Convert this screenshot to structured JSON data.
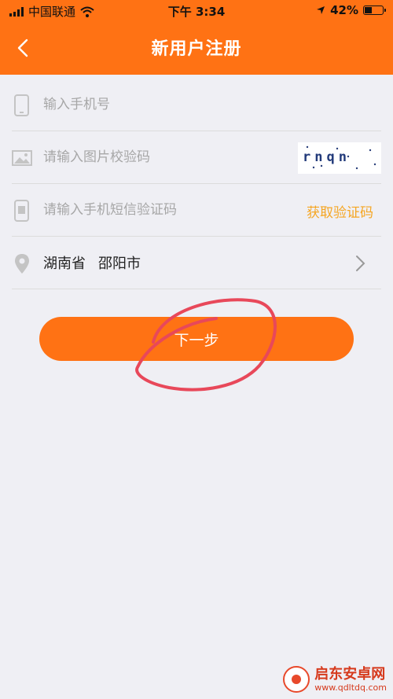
{
  "status_bar": {
    "carrier": "中国联通",
    "time": "下午 3:34",
    "battery": "42%",
    "battery_level": 0.42
  },
  "header": {
    "title": "新用户注册",
    "background": "#ff7214"
  },
  "form": {
    "phone": {
      "placeholder": "输入手机号",
      "value": ""
    },
    "image_code": {
      "placeholder": "请输入图片校验码",
      "value": "",
      "captcha_text": "rnqn"
    },
    "sms_code": {
      "placeholder": "请输入手机短信验证码",
      "value": "",
      "get_code_label": "获取验证码"
    },
    "region": {
      "province": "湖南省",
      "city": "邵阳市"
    }
  },
  "next_button": {
    "label": "下一步"
  },
  "watermark": {
    "name": "启东安卓网",
    "url": "www.qdltdq.com"
  },
  "colors": {
    "accent": "#ff7214",
    "link": "#f5a623",
    "annotation": "#e8485a"
  },
  "icons": [
    "signal-icon",
    "wifi-icon",
    "location-arrow-icon",
    "battery-icon",
    "back-icon",
    "phone-icon",
    "image-icon",
    "sms-phone-icon",
    "location-pin-icon",
    "chevron-right-icon"
  ]
}
